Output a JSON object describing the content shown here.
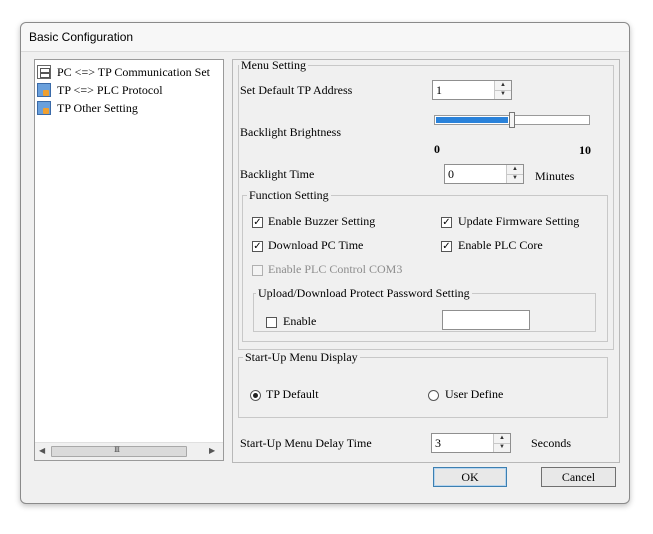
{
  "window": {
    "title": "Basic Configuration"
  },
  "tree": {
    "items": [
      {
        "label": "PC <=> TP Communication Set",
        "icon": "connection-icon"
      },
      {
        "label": "TP <=> PLC Protocol",
        "icon": "device-icon"
      },
      {
        "label": "TP Other Setting",
        "icon": "settings-device-icon"
      }
    ],
    "scroll_grip": "III"
  },
  "menu_setting": {
    "legend": "Menu Setting",
    "tp_address_label": "Set Default TP Address",
    "tp_address_value": "1",
    "backlight_brightness_label": "Backlight Brightness",
    "brightness_min": "0",
    "brightness_max": "10",
    "brightness_level": 0.5,
    "backlight_time_label": "Backlight Time",
    "backlight_time_value": "0",
    "backlight_time_unit": "Minutes"
  },
  "function_setting": {
    "legend": "Function Setting",
    "enable_buzzer": {
      "label": "Enable Buzzer Setting",
      "checked": true
    },
    "update_firmware": {
      "label": "Update Firmware Setting",
      "checked": true
    },
    "download_pc_time": {
      "label": "Download PC Time",
      "checked": true
    },
    "enable_plc_core": {
      "label": "Enable PLC Core",
      "checked": true
    },
    "enable_plc_com3": {
      "label": "Enable PLC Control COM3",
      "checked": false,
      "disabled": true
    },
    "password_group": {
      "legend": "Upload/Download Protect Password Setting",
      "enable_label": "Enable",
      "enable_checked": false,
      "password_value": ""
    }
  },
  "startup_menu": {
    "legend": "Start-Up Menu Display",
    "tp_default_label": "TP Default",
    "user_define_label": "User Define",
    "selected": "TP Default"
  },
  "startup_delay": {
    "label": "Start-Up Menu Delay Time",
    "value": "3",
    "unit": "Seconds"
  },
  "buttons": {
    "ok": "OK",
    "cancel": "Cancel"
  },
  "colors": {
    "accent": "#2a82da",
    "disabled_text": "#8d8d8d"
  }
}
